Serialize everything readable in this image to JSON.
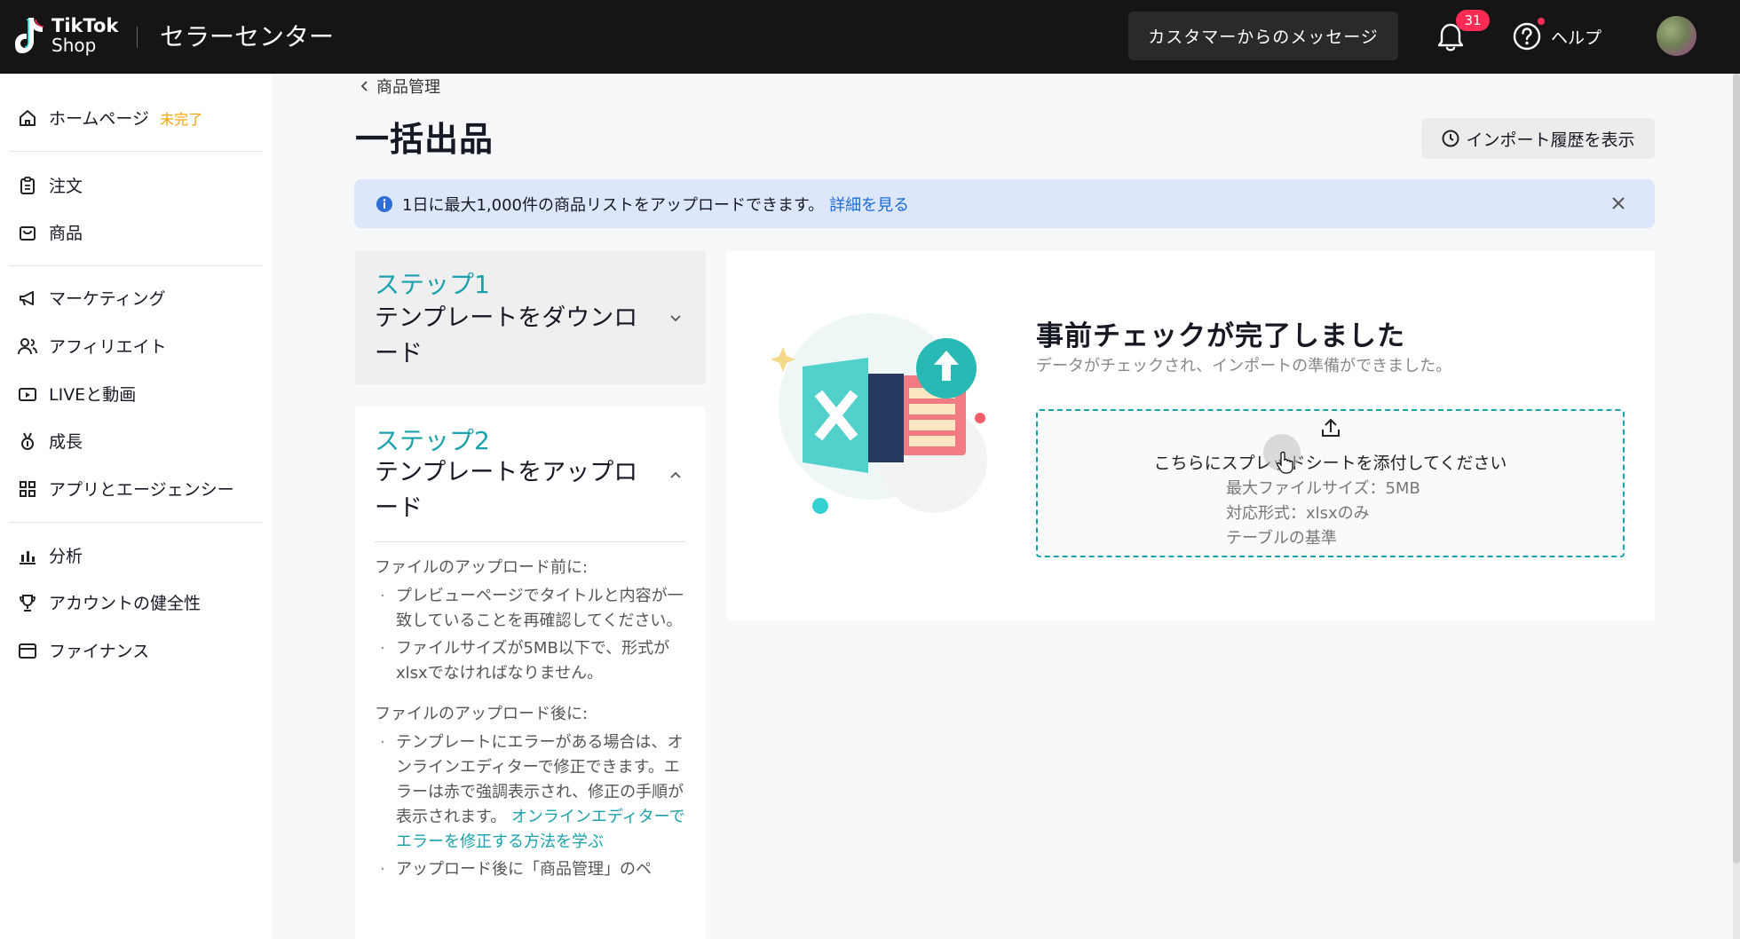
{
  "header": {
    "logo_line1": "TikTok",
    "logo_line2": "Shop",
    "brand": "セラーセンター",
    "messages_button": "カスタマーからのメッセージ",
    "notification_count": "31",
    "help_label": "ヘルプ"
  },
  "sidebar": {
    "items": [
      {
        "label": "ホームページ",
        "badge": "未完了",
        "icon": "home-icon"
      },
      {
        "label": "注文",
        "icon": "clipboard-icon"
      },
      {
        "label": "商品",
        "icon": "bag-icon"
      },
      {
        "label": "マーケティング",
        "icon": "megaphone-icon"
      },
      {
        "label": "アフィリエイト",
        "icon": "people-icon"
      },
      {
        "label": "LIVEと動画",
        "icon": "video-icon"
      },
      {
        "label": "成長",
        "icon": "medal-icon"
      },
      {
        "label": "アプリとエージェンシー",
        "icon": "apps-icon"
      },
      {
        "label": "分析",
        "icon": "chart-icon"
      },
      {
        "label": "アカウントの健全性",
        "icon": "trophy-icon"
      },
      {
        "label": "ファイナンス",
        "icon": "wallet-icon"
      }
    ]
  },
  "page": {
    "breadcrumb": "商品管理",
    "title": "一括出品",
    "history_button": "インポート履歴を表示",
    "banner_text": "1日に最大1,000件の商品リストをアップロードできます。",
    "banner_link": "詳細を見る"
  },
  "steps": {
    "step1": {
      "label": "ステップ1",
      "title": "テンプレートをダウンロード"
    },
    "step2": {
      "label": "ステップ2",
      "title": "テンプレートをアップロード",
      "before_heading": "ファイルのアップロード前に:",
      "before_bullet1": "プレビューページでタイトルと内容が一致していることを再確認してください。",
      "before_bullet2": "ファイルサイズが5MB以下で、形式がxlsxでなければなりません。",
      "after_heading": "ファイルのアップロード後に:",
      "after_bullet1": "テンプレートにエラーがある場合は、オンラインエディターで修正できます。エラーは赤で強調表示され、修正の手順が表示されます。",
      "after_link": "オンラインエディターでエラーを修正する方法を学ぶ",
      "after_bullet2": "アップロード後に「商品管理」のペ"
    }
  },
  "panel": {
    "title": "事前チェックが完了しました",
    "subtitle": "データがチェックされ、インポートの準備ができました。",
    "upload_text": "こちらにスプレッドシートを添付してください",
    "max_size": "最大ファイルサイズ：5MB",
    "format": "対応形式：xlsxのみ",
    "standard": "テーブルの基準"
  },
  "colors": {
    "accent": "#1ba1ad",
    "topbar": "#151515",
    "badge": "#fe2c55",
    "link": "#1a6bd4",
    "warning": "#f1a200"
  }
}
